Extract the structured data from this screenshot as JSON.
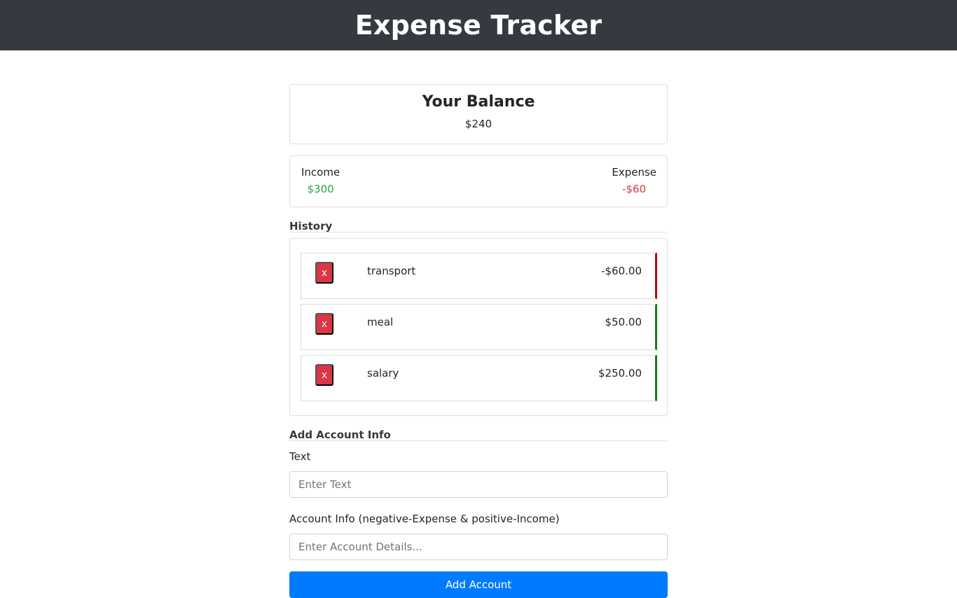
{
  "app": {
    "title": "Expense Tracker"
  },
  "balance": {
    "heading": "Your Balance",
    "amount": "$240"
  },
  "summary": {
    "income_label": "Income",
    "income_value": "$300",
    "expense_label": "Expense",
    "expense_value": "-$60"
  },
  "history": {
    "title": "History",
    "delete_label": "x",
    "items": [
      {
        "name": "transport",
        "amount": "-$60.00",
        "kind": "minus"
      },
      {
        "name": "meal",
        "amount": "$50.00",
        "kind": "plus"
      },
      {
        "name": "salary",
        "amount": "$250.00",
        "kind": "plus"
      }
    ]
  },
  "form": {
    "title": "Add Account Info",
    "text_label": "Text",
    "text_placeholder": "Enter Text",
    "amount_label": "Account Info (negative-Expense & positive-Income)",
    "amount_placeholder": "Enter Account Details...",
    "submit_label": "Add Account"
  },
  "colors": {
    "navbar": "#343a40",
    "income": "#28a745",
    "expense": "#dc3545",
    "primary": "#007bff",
    "minus_border": "#c00000",
    "plus_border": "#118011"
  }
}
